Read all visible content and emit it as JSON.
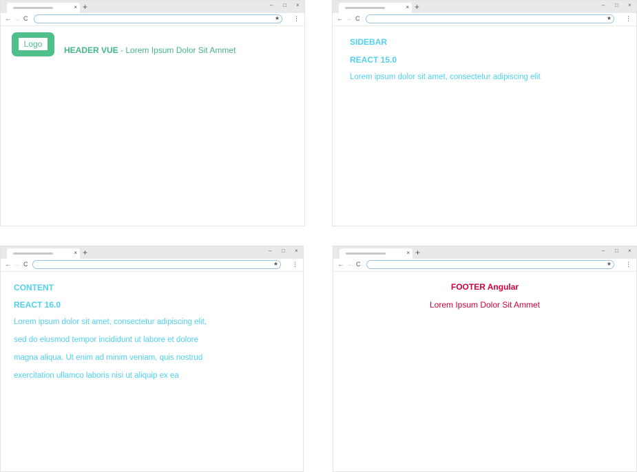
{
  "browser": {
    "tab_close": "×",
    "new_tab": "+",
    "minimize": "–",
    "maximize": "□",
    "close": "×",
    "back": "←",
    "forward": "→",
    "reload": "C",
    "star": "★",
    "menu": "⋮"
  },
  "header": {
    "logo_label": "Logo",
    "title_bold": "HEADER VUE",
    "title_rest": " - Lorem Ipsum Dolor Sit Ammet",
    "accent": "#4fbf8c"
  },
  "sidebar": {
    "title": "SIDEBAR",
    "version": "REACT 15.0",
    "text": "Lorem ipsum dolor sit amet, consectetur  adipiscing elit",
    "accent": "#4fd1ef"
  },
  "content": {
    "title": "CONTENT",
    "version": "REACT 16.0",
    "lines": [
      "Lorem ipsum dolor sit amet, consectetur adipiscing elit,",
      "sed do eiusmod tempor incididunt ut labore et dolore",
      "magna aliqua. Ut enim ad minim veniam, quis nostrud",
      "exercitation ullamco laboris nisi ut aliquip ex ea"
    ],
    "accent": "#4fd1ef"
  },
  "footer": {
    "title": "FOOTER Angular",
    "text": "Lorem Ipsum Dolor Sit Ammet",
    "accent": "#d3003b"
  }
}
